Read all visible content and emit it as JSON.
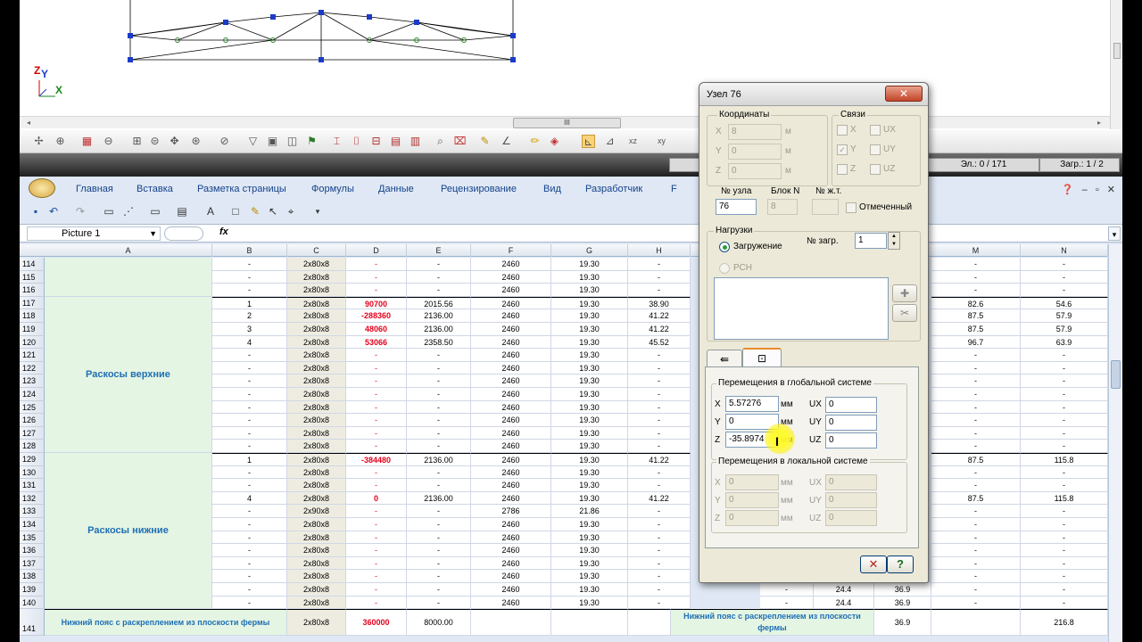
{
  "cad": {
    "axis": {
      "z": "Z",
      "y": "Y",
      "x": "X"
    },
    "hscroll_thumb": "III",
    "status": {
      "elements": "Эл.: 0 / 171",
      "loads": "Загр.: 1 / 2"
    }
  },
  "excel": {
    "ribbon_tabs": [
      "Главная",
      "Вставка",
      "Разметка страницы",
      "Формулы",
      "Данные",
      "Рецензирование",
      "Вид",
      "Разработчик",
      "F"
    ],
    "name_box": "Picture 1",
    "fx": "fx",
    "col_headers": [
      "A",
      "B",
      "C",
      "D",
      "E",
      "F",
      "G",
      "H",
      "M",
      "N"
    ],
    "groups": {
      "upper": "Раскосы верхние",
      "lower": "Раскосы нижние",
      "bottom_chord": "Нижний пояс с раскреплением из плоскости фермы"
    },
    "rows": [
      {
        "n": "114",
        "b": "-",
        "c": "2x80x8",
        "d": "-",
        "e": "-",
        "f": "2460",
        "g": "19.30",
        "h": "-",
        "m": "-",
        "nn": "-"
      },
      {
        "n": "115",
        "b": "-",
        "c": "2x80x8",
        "d": "-",
        "e": "-",
        "f": "2460",
        "g": "19.30",
        "h": "-",
        "m": "-",
        "nn": "-"
      },
      {
        "n": "116",
        "b": "-",
        "c": "2x80x8",
        "d": "-",
        "e": "-",
        "f": "2460",
        "g": "19.30",
        "h": "-",
        "m": "-",
        "nn": "-"
      },
      {
        "n": "117",
        "b": "1",
        "c": "2x80x8",
        "d": "90700",
        "e": "2015.56",
        "f": "2460",
        "g": "19.30",
        "h": "38.90",
        "m": "82.6",
        "nn": "54.6"
      },
      {
        "n": "118",
        "b": "2",
        "c": "2x80x8",
        "d": "-288360",
        "e": "2136.00",
        "f": "2460",
        "g": "19.30",
        "h": "41.22",
        "m": "87.5",
        "nn": "57.9"
      },
      {
        "n": "119",
        "b": "3",
        "c": "2x80x8",
        "d": "48060",
        "e": "2136.00",
        "f": "2460",
        "g": "19.30",
        "h": "41.22",
        "m": "87.5",
        "nn": "57.9"
      },
      {
        "n": "120",
        "b": "4",
        "c": "2x80x8",
        "d": "53066",
        "e": "2358.50",
        "f": "2460",
        "g": "19.30",
        "h": "45.52",
        "m": "96.7",
        "nn": "63.9"
      },
      {
        "n": "121",
        "b": "-",
        "c": "2x80x8",
        "d": "-",
        "e": "-",
        "f": "2460",
        "g": "19.30",
        "h": "-",
        "m": "-",
        "nn": "-"
      },
      {
        "n": "122",
        "b": "-",
        "c": "2x80x8",
        "d": "-",
        "e": "-",
        "f": "2460",
        "g": "19.30",
        "h": "-",
        "m": "-",
        "nn": "-"
      },
      {
        "n": "123",
        "b": "-",
        "c": "2x80x8",
        "d": "-",
        "e": "-",
        "f": "2460",
        "g": "19.30",
        "h": "-",
        "m": "-",
        "nn": "-"
      },
      {
        "n": "124",
        "b": "-",
        "c": "2x80x8",
        "d": "-",
        "e": "-",
        "f": "2460",
        "g": "19.30",
        "h": "-",
        "m": "-",
        "nn": "-"
      },
      {
        "n": "125",
        "b": "-",
        "c": "2x80x8",
        "d": "-",
        "e": "-",
        "f": "2460",
        "g": "19.30",
        "h": "-",
        "m": "-",
        "nn": "-"
      },
      {
        "n": "126",
        "b": "-",
        "c": "2x80x8",
        "d": "-",
        "e": "-",
        "f": "2460",
        "g": "19.30",
        "h": "-",
        "m": "-",
        "nn": "-"
      },
      {
        "n": "127",
        "b": "-",
        "c": "2x80x8",
        "d": "-",
        "e": "-",
        "f": "2460",
        "g": "19.30",
        "h": "-",
        "m": "-",
        "nn": "-"
      },
      {
        "n": "128",
        "b": "-",
        "c": "2x80x8",
        "d": "-",
        "e": "-",
        "f": "2460",
        "g": "19.30",
        "h": "-",
        "m": "-",
        "nn": "-"
      },
      {
        "n": "129",
        "b": "1",
        "c": "2x80x8",
        "d": "-384480",
        "e": "2136.00",
        "f": "2460",
        "g": "19.30",
        "h": "41.22",
        "m": "87.5",
        "nn": "115.8"
      },
      {
        "n": "130",
        "b": "-",
        "c": "2x80x8",
        "d": "-",
        "e": "-",
        "f": "2460",
        "g": "19.30",
        "h": "-",
        "m": "-",
        "nn": "-"
      },
      {
        "n": "131",
        "b": "-",
        "c": "2x80x8",
        "d": "-",
        "e": "-",
        "f": "2460",
        "g": "19.30",
        "h": "-",
        "m": "-",
        "nn": "-"
      },
      {
        "n": "132",
        "b": "4",
        "c": "2x80x8",
        "d": "0",
        "e": "2136.00",
        "f": "2460",
        "g": "19.30",
        "h": "41.22",
        "m": "87.5",
        "nn": "115.8"
      },
      {
        "n": "133",
        "b": "-",
        "c": "2x90x8",
        "d": "-",
        "e": "-",
        "f": "2786",
        "g": "21.86",
        "h": "-",
        "m": "-",
        "nn": "-"
      },
      {
        "n": "134",
        "b": "-",
        "c": "2x80x8",
        "d": "-",
        "e": "-",
        "f": "2460",
        "g": "19.30",
        "h": "-",
        "m": "-",
        "nn": "-"
      },
      {
        "n": "135",
        "b": "-",
        "c": "2x80x8",
        "d": "-",
        "e": "-",
        "f": "2460",
        "g": "19.30",
        "h": "-",
        "m": "-",
        "nn": "-"
      },
      {
        "n": "136",
        "b": "-",
        "c": "2x80x8",
        "d": "-",
        "e": "-",
        "f": "2460",
        "g": "19.30",
        "h": "-",
        "m": "-",
        "nn": "-"
      },
      {
        "n": "137",
        "b": "-",
        "c": "2x80x8",
        "d": "-",
        "e": "-",
        "f": "2460",
        "g": "19.30",
        "h": "-",
        "m": "-",
        "nn": "-"
      },
      {
        "n": "138",
        "b": "-",
        "c": "2x80x8",
        "d": "-",
        "e": "-",
        "f": "2460",
        "g": "19.30",
        "h": "-",
        "m": "-",
        "nn": "-"
      },
      {
        "n": "139",
        "b": "-",
        "c": "2x80x8",
        "d": "-",
        "e": "-",
        "f": "2460",
        "g": "19.30",
        "h": "-",
        "m": "-",
        "nn": "-"
      },
      {
        "n": "140",
        "b": "-",
        "c": "2x80x8",
        "d": "-",
        "e": "-",
        "f": "2460",
        "g": "19.30",
        "h": "-",
        "m": "-",
        "nn": "-"
      }
    ],
    "hidden_cols_visible": [
      {
        "row": "139",
        "k": "-",
        "l": "24.4",
        "m2": "36.9"
      },
      {
        "row": "140",
        "k": "-",
        "l": "24.4",
        "m2": "36.9"
      }
    ],
    "row141": {
      "n": "141",
      "c": "2x80x8",
      "d": "360000",
      "e": "8000.00",
      "l": "36.9",
      "nn": "216.8"
    }
  },
  "dialog": {
    "title": "Узел 76",
    "close": "✕",
    "coords": {
      "label": "Координаты",
      "x_label": "X",
      "y_label": "Y",
      "z_label": "Z",
      "x": "8",
      "y": "0",
      "z": "0",
      "unit": "м"
    },
    "links": {
      "label": "Связи",
      "x": "X",
      "y": "Y",
      "z": "Z",
      "ux": "UX",
      "uy": "UY",
      "uz": "UZ",
      "check_mark": "✓"
    },
    "node_no_label": "№ узла",
    "node_no": "76",
    "block_label": "Блок N",
    "block": "8",
    "rigid_label": "№ ж.т.",
    "marked_label": "Отмеченный",
    "loads": {
      "label": "Нагрузки",
      "loading": "Загружение",
      "load_no_label": "№ загр.",
      "load_no": "1",
      "rsn": "РСН"
    },
    "global": {
      "label": "Перемещения в глобальной системе",
      "x_label": "X",
      "y_label": "Y",
      "z_label": "Z",
      "x": "5.57276",
      "y": "0",
      "z": "-35.8974",
      "unit": "мм",
      "ux_label": "UX",
      "uy_label": "UY",
      "uz_label": "UZ",
      "ux": "0",
      "uy": "0",
      "uz": "0"
    },
    "local": {
      "label": "Перемещения в локальной системе",
      "x_label": "X",
      "y_label": "Y",
      "z_label": "Z",
      "x": "0",
      "y": "0",
      "z": "0",
      "unit": "мм",
      "ux_label": "UX",
      "uy_label": "UY",
      "uz_label": "UZ",
      "ux": "0",
      "uy": "0",
      "uz": "0"
    },
    "btn_cancel": "✕",
    "btn_help": "?"
  },
  "colors": {
    "red_value": "#e4001b",
    "group_text": "#1f6fb4",
    "group_bg": "#e4f5e4"
  }
}
